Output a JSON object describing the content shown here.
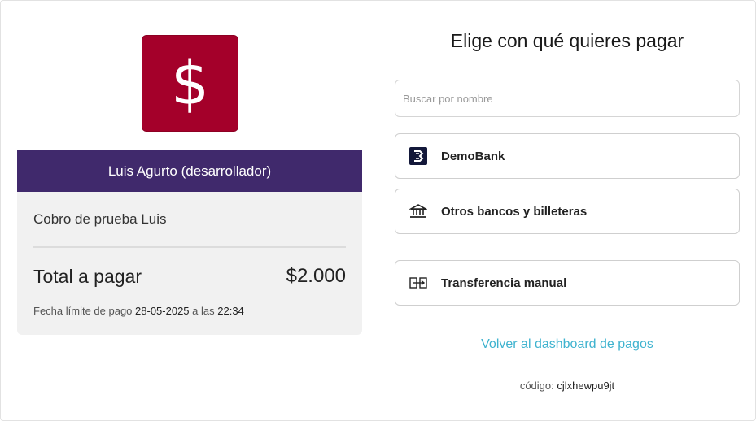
{
  "merchant": {
    "logo_symbol": "$",
    "logo_color": "#a4002a",
    "name": "Luis Agurto (desarrollador)",
    "bar_color": "#40296c"
  },
  "summary": {
    "concept": "Cobro de prueba Luis",
    "total_label": "Total a pagar",
    "total_amount": "$2.000",
    "deadline_prefix": "Fecha límite de pago",
    "deadline_date": "28-05-2025",
    "deadline_mid": "a las",
    "deadline_time": "22:34"
  },
  "payment": {
    "title": "Elige con qué quieres pagar",
    "search_placeholder": "Buscar por nombre",
    "options": [
      {
        "label": "DemoBank",
        "icon": "demobank-logo-icon"
      },
      {
        "label": "Otros bancos y billeteras",
        "icon": "bank-building-icon"
      },
      {
        "label": "Transferencia manual",
        "icon": "transfer-icon"
      }
    ],
    "back_link": "Volver al dashboard de pagos",
    "link_color": "#3fb3cf",
    "code_label": "código:",
    "code_value": "cjlxhewpu9jt"
  }
}
